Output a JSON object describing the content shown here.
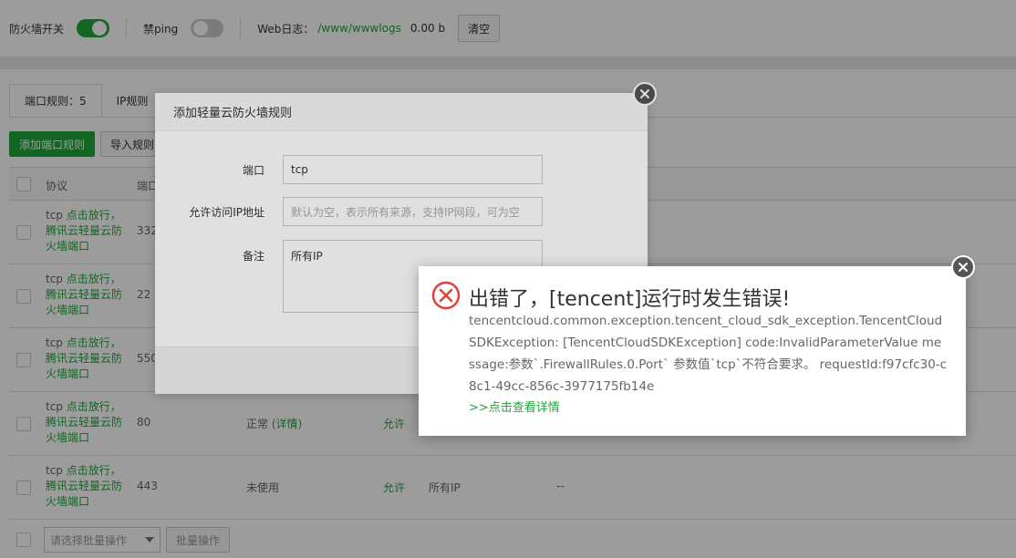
{
  "topbar": {
    "firewall_label": "防火墙开关",
    "firewall_on": true,
    "ping_label": "禁ping",
    "ping_on": false,
    "weblog_label": "Web日志：",
    "weblog_path": "/www/wwwlogs",
    "weblog_size": "0.00 b",
    "clear_label": "清空"
  },
  "tabs": [
    {
      "label": "端口规则：5"
    },
    {
      "label": "IP规则"
    }
  ],
  "actions": {
    "add_label": "添加端口规则",
    "import_label": "导入规则"
  },
  "table": {
    "headers": {
      "protocol": "协议",
      "port": "端口"
    },
    "rows": [
      {
        "proto": "tcp",
        "note": "点击放行，腾讯云轻量云防火墙端口",
        "port": "332",
        "status": "",
        "status_link": "",
        "action": "",
        "source": "",
        "remark": ""
      },
      {
        "proto": "tcp",
        "note": "点击放行，腾讯云轻量云防火墙端口",
        "port": "22",
        "status": "",
        "status_link": "",
        "action": "",
        "source": "",
        "remark": ""
      },
      {
        "proto": "tcp",
        "note": "点击放行，腾讯云轻量云防火墙端口",
        "port": "550",
        "status": "",
        "status_link": "",
        "action": "",
        "source": "",
        "remark": ""
      },
      {
        "proto": "tcp",
        "note": "点击放行，腾讯云轻量云防火墙端口",
        "port": "80",
        "status": "正常",
        "status_link": "(详情)",
        "action": "允许",
        "source": "",
        "remark": ""
      },
      {
        "proto": "tcp",
        "note": "点击放行，腾讯云轻量云防火墙端口",
        "port": "443",
        "status": "未使用",
        "status_link": "",
        "action": "允许",
        "source": "所有IP",
        "remark": "--"
      }
    ]
  },
  "footer": {
    "batch_placeholder": "请选择批量操作",
    "batch_button": "批量操作"
  },
  "dialog": {
    "title": "添加轻量云防火墙规则",
    "port_label": "端口",
    "port_value": "tcp",
    "ip_label": "允许访问IP地址",
    "ip_placeholder": "默认为空，表示所有来源，支持IP网段，可为空",
    "remark_label": "备注",
    "remark_value": "所有IP"
  },
  "error": {
    "title": "出错了，[tencent]运行时发生错误!",
    "message": "tencentcloud.common.exception.tencent_cloud_sdk_exception.TencentCloudSDKException: [TencentCloudSDKException] code:InvalidParameterValue message:参数`.FirewallRules.0.Port` 参数值`tcp`不符合要求。 requestId:f97cfc30-c8c1-49cc-856c-3977175fb14e",
    "link": ">>点击查看详情"
  },
  "colors": {
    "accent": "#20a53a",
    "error": "#e2403a"
  }
}
